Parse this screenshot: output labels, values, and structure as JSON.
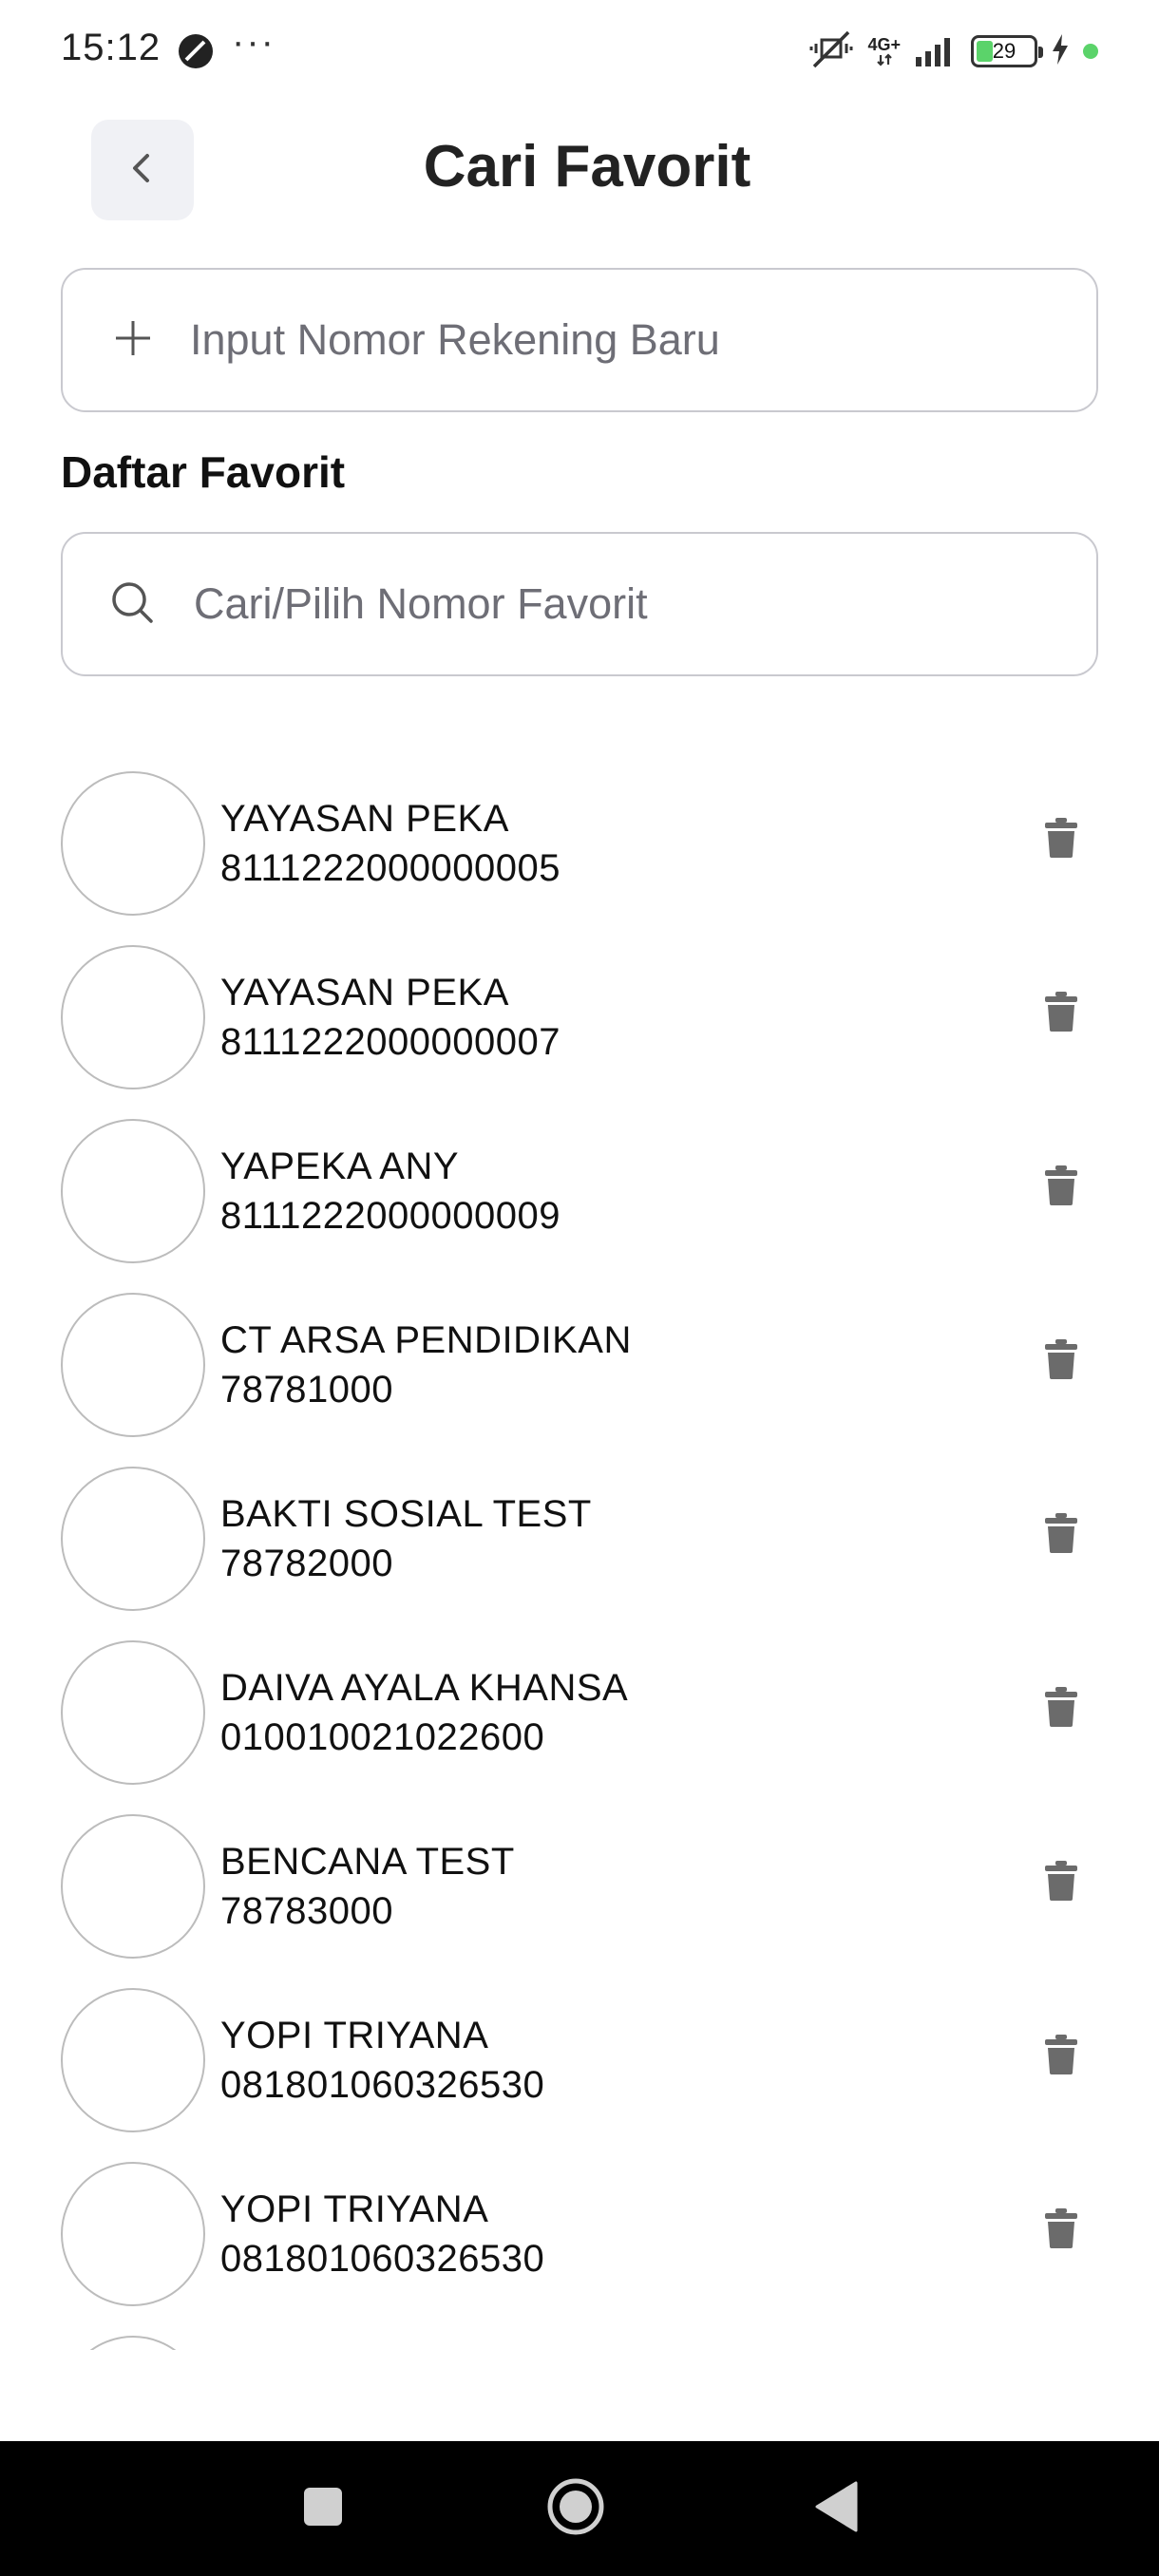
{
  "status_bar": {
    "time": "15:12",
    "more": "···",
    "network": "4G+",
    "battery": "29",
    "battery_level_percent": 29
  },
  "header": {
    "title": "Cari Favorit",
    "back_icon": "chevron-left-icon"
  },
  "new_account": {
    "placeholder": "Input Nomor Rekening Baru",
    "icon": "plus-icon"
  },
  "favorites": {
    "section_title": "Daftar Favorit",
    "search_placeholder": "Cari/Pilih Nomor Favorit",
    "search_icon": "search-icon",
    "delete_icon": "trash-icon",
    "items": [
      {
        "name": "YAYASAN PEKA",
        "number": "8111222000000005"
      },
      {
        "name": "YAYASAN PEKA",
        "number": "8111222000000007"
      },
      {
        "name": "YAPEKA ANY",
        "number": "8111222000000009"
      },
      {
        "name": "CT ARSA PENDIDIKAN",
        "number": "78781000"
      },
      {
        "name": "BAKTI SOSIAL TEST",
        "number": "78782000"
      },
      {
        "name": "DAIVA AYALA KHANSA",
        "number": "010010021022600"
      },
      {
        "name": "BENCANA TEST",
        "number": "78783000"
      },
      {
        "name": "YOPI TRIYANA",
        "number": "081801060326530"
      },
      {
        "name": "YOPI TRIYANA",
        "number": "081801060326530"
      }
    ]
  },
  "nav_bar": {
    "recents_icon": "square-icon",
    "home_icon": "circle-home-icon",
    "back_icon": "triangle-back-icon"
  },
  "colors": {
    "accent_green": "#5bd36a",
    "icon_gray": "#6b6b6b",
    "border_gray": "#c9c9cf",
    "back_button_bg": "#f0f1f5"
  }
}
